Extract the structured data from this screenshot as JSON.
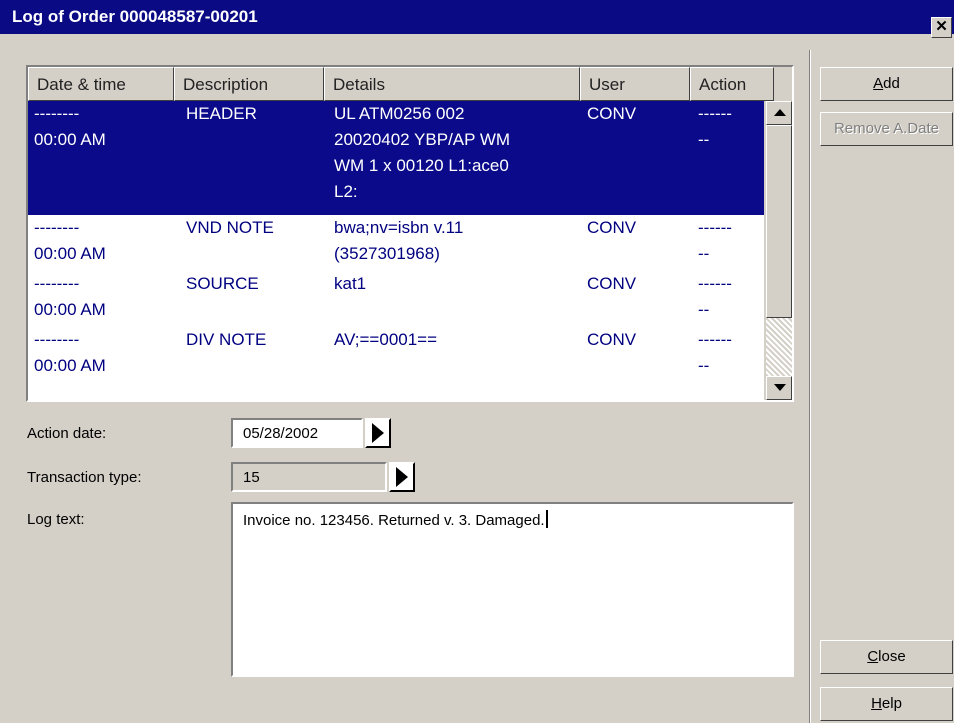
{
  "window": {
    "title": "Log of Order 000048587-00201",
    "close_glyph": "✕"
  },
  "table": {
    "headers": [
      "Date & time",
      "Description",
      "Details",
      "User",
      "Action"
    ],
    "rows": [
      {
        "date": [
          "--------",
          "00:00 AM"
        ],
        "description": "HEADER",
        "details": [
          "UL ATM0256 002",
          "20020402 YBP/AP WM",
          "WM 1 x 00120 L1:ace0",
          "L2:"
        ],
        "user": "CONV",
        "action": [
          "------",
          "--"
        ],
        "selected": true
      },
      {
        "date": [
          "--------",
          "00:00 AM"
        ],
        "description": "VND NOTE",
        "details": [
          "bwa;nv=isbn v.11",
          "(3527301968)"
        ],
        "user": "CONV",
        "action": [
          "------",
          "--"
        ],
        "selected": false
      },
      {
        "date": [
          "--------",
          "00:00 AM"
        ],
        "description": "SOURCE",
        "details": [
          "kat1"
        ],
        "user": "CONV",
        "action": [
          "------",
          "--"
        ],
        "selected": false
      },
      {
        "date": [
          "--------",
          "00:00 AM"
        ],
        "description": "DIV NOTE",
        "details": [
          "AV;==0001=="
        ],
        "user": "CONV",
        "action": [
          "------",
          "--"
        ],
        "selected": false
      }
    ]
  },
  "form": {
    "action_date_label": "Action date:",
    "action_date_value": "05/28/2002",
    "transaction_type_label": "Transaction type:",
    "transaction_type_value": "15",
    "log_text_label": "Log text:",
    "log_text_value": "Invoice no. 123456. Returned v. 3. Damaged."
  },
  "buttons": {
    "add": {
      "mnemonic": "A",
      "rest": "dd"
    },
    "remove": "Remove A.Date",
    "close": {
      "mnemonic": "C",
      "rest": "lose"
    },
    "help": {
      "mnemonic": "H",
      "rest": "elp"
    }
  },
  "colors": {
    "selection": "#0a0a8a",
    "title_bar": "#0a0a84",
    "text_blue": "#000080",
    "face": "#d4d0c8"
  }
}
